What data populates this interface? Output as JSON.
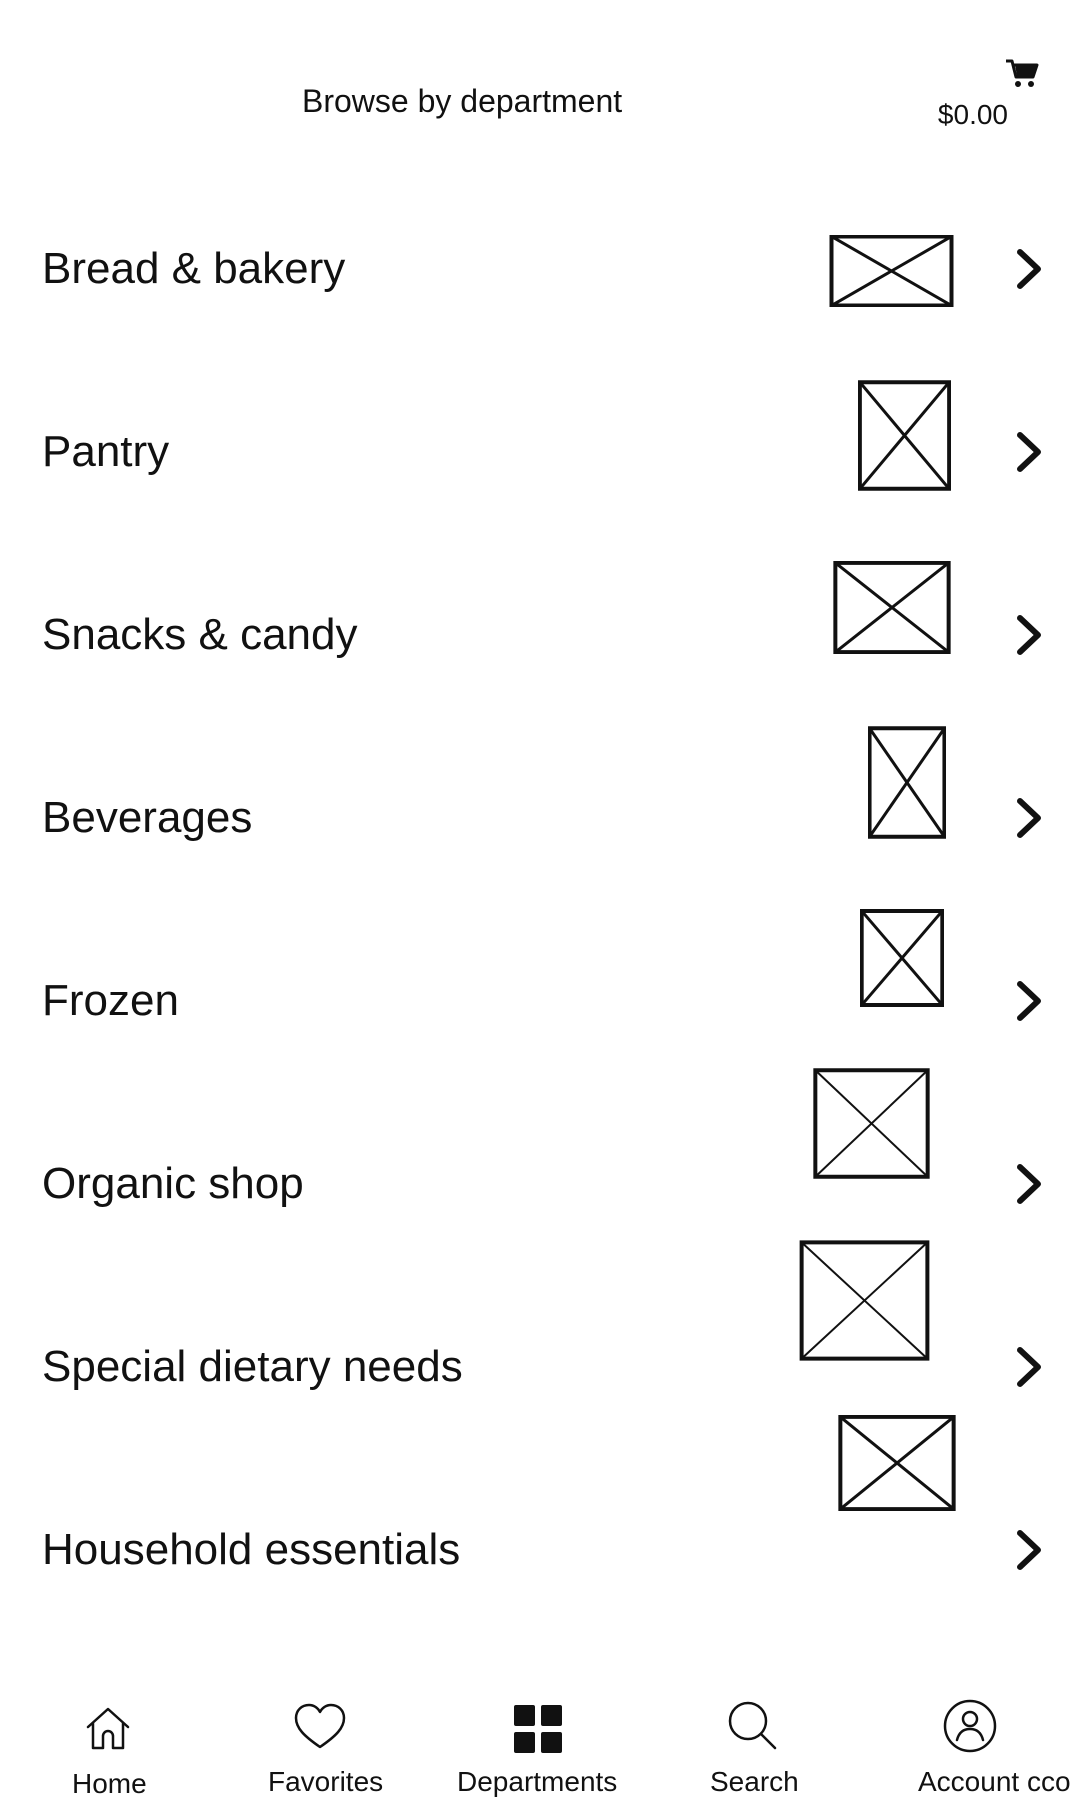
{
  "header": {
    "title": "Browse by department",
    "cart_total": "$0.00",
    "cart_icon": "cart-icon"
  },
  "departments": [
    {
      "label": "Bread & bakery",
      "thumbnail": "image-placeholder-icon",
      "chevron": "chevron-right-icon"
    },
    {
      "label": "Pantry",
      "thumbnail": "image-placeholder-icon",
      "chevron": "chevron-right-icon"
    },
    {
      "label": "Snacks & candy",
      "thumbnail": "image-placeholder-icon",
      "chevron": "chevron-right-icon"
    },
    {
      "label": "Beverages",
      "thumbnail": "image-placeholder-icon",
      "chevron": "chevron-right-icon"
    },
    {
      "label": "Frozen",
      "thumbnail": "image-placeholder-icon",
      "chevron": "chevron-right-icon"
    },
    {
      "label": "Organic shop",
      "thumbnail": "image-placeholder-icon",
      "chevron": "chevron-right-icon"
    },
    {
      "label": "Special dietary needs",
      "thumbnail": "image-placeholder-icon",
      "chevron": "chevron-right-icon"
    },
    {
      "label": "Household essentials",
      "thumbnail": "image-placeholder-icon",
      "chevron": "chevron-right-icon"
    }
  ],
  "bottom_nav": [
    {
      "label": "Home",
      "icon": "home-icon"
    },
    {
      "label": "Favorites",
      "icon": "heart-icon"
    },
    {
      "label": "Departments",
      "icon": "grid-icon",
      "active": true
    },
    {
      "label": "Search",
      "icon": "search-icon"
    },
    {
      "label": "Account cco",
      "icon": "account-icon"
    }
  ]
}
